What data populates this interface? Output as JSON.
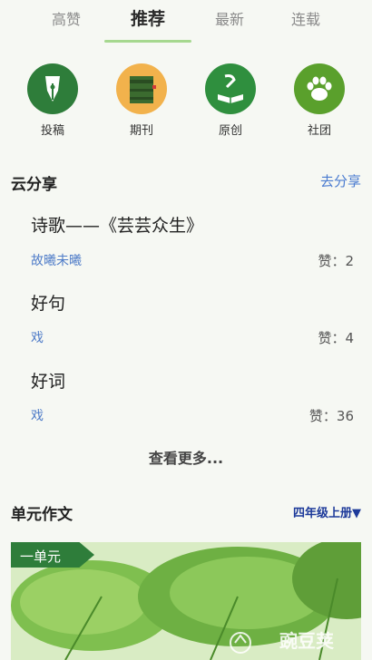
{
  "tabs": [
    {
      "label": "高赞"
    },
    {
      "label": "推荐"
    },
    {
      "label": "最新"
    },
    {
      "label": "连载"
    }
  ],
  "categories": [
    {
      "label": "投稿",
      "icon": "fountain-pen-icon",
      "color": "#2e7d3a"
    },
    {
      "label": "期刊",
      "icon": "journal-book-icon",
      "color": "#f2b24c"
    },
    {
      "label": "原创",
      "icon": "original-book-icon",
      "color": "#2f8f3e"
    },
    {
      "label": "社团",
      "icon": "paw-icon",
      "color": "#5aa02c"
    }
  ],
  "cloud_share": {
    "title": "云分享",
    "link": "去分享",
    "posts": [
      {
        "title": "诗歌——《芸芸众生》",
        "author": "故曦未曦",
        "likes": "赞：2"
      },
      {
        "title": "好句",
        "author": "戏",
        "likes": "赞：4"
      },
      {
        "title": "好词",
        "author": "戏",
        "likes": "赞：36"
      }
    ],
    "more": "查看更多..."
  },
  "unit_essay": {
    "title": "单元作文",
    "grade": "四年级上册▼",
    "banner_tag": "一单元",
    "watermark": "豌豆荚"
  },
  "colors": {
    "accent_green": "#a6d88f",
    "link_blue": "#4a7bd0",
    "grade_blue": "#1d3a9a"
  }
}
